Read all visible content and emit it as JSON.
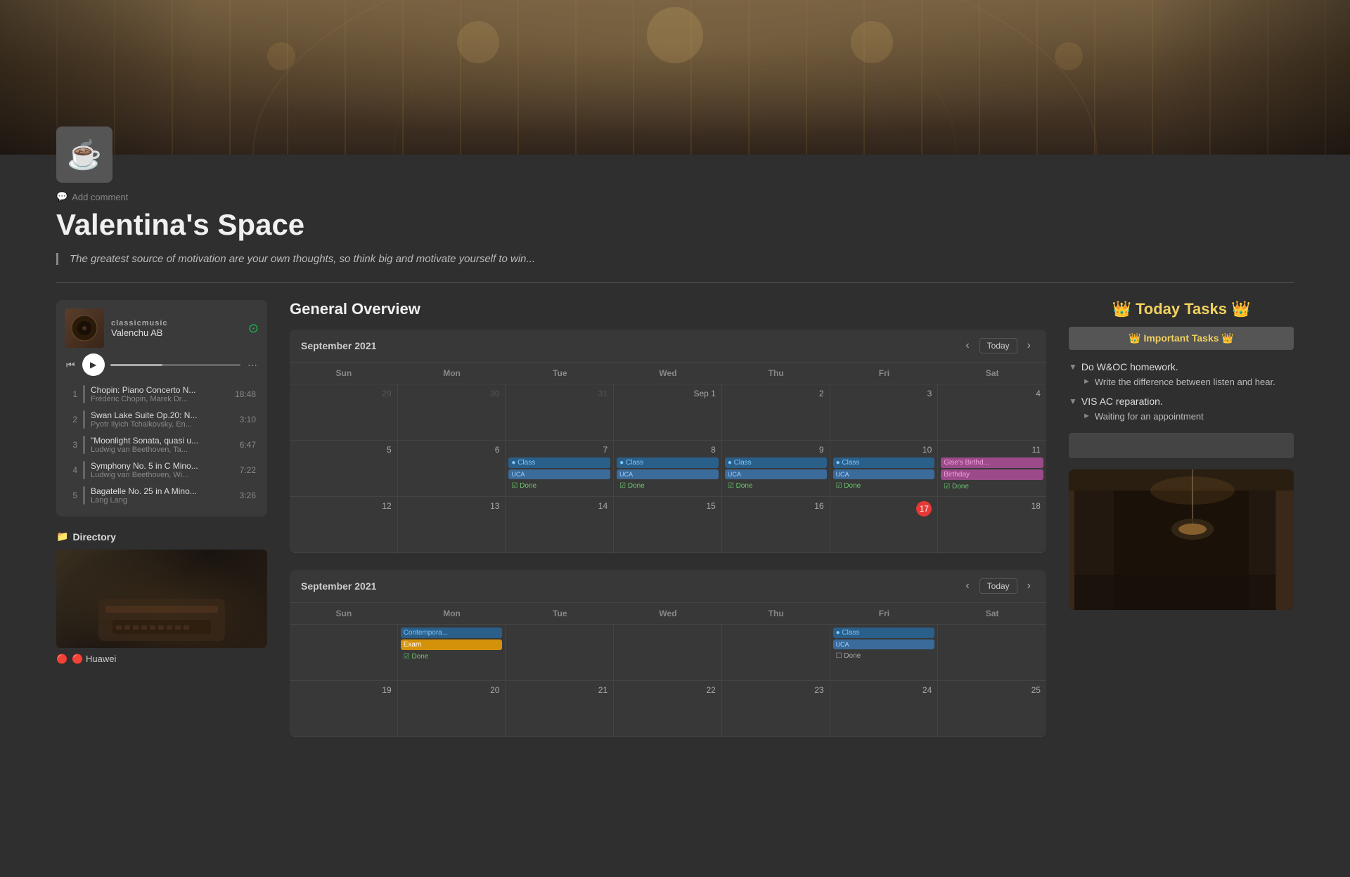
{
  "header": {
    "banner_alt": "Library grand hall banner"
  },
  "page": {
    "avatar_emoji": "☕",
    "add_comment_label": "Add comment",
    "title": "Valentina's Space",
    "quote": "The greatest source of motivation are your own thoughts, so think big and motivate yourself to win..."
  },
  "music_player": {
    "label": "classicmusic",
    "artist": "Valenchu AB",
    "tracks": [
      {
        "num": "1",
        "title": "Chopin: Piano Concerto N...",
        "artist": "Frédéric Chopin, Marek Dr...",
        "duration": "18:48"
      },
      {
        "num": "2",
        "title": "Swan Lake Suite Op.20: N...",
        "artist": "Pyotr Ilyich Tchaikovsky, En...",
        "duration": "3:10"
      },
      {
        "num": "3",
        "title": "\"Moonlight Sonata, quasi u...",
        "artist": "Ludwig van Beethoven, Ta...",
        "duration": "6:47"
      },
      {
        "num": "4",
        "title": "Symphony No. 5 in C Mino...",
        "artist": "Ludwig van Beethoven, Wi...",
        "duration": "7:22"
      },
      {
        "num": "5",
        "title": "Bagatelle No. 25 in A Mino...",
        "artist": "Lang Lang",
        "duration": "3:26"
      }
    ]
  },
  "directory": {
    "title": "📁 Directory",
    "label": "🔴 Huawei"
  },
  "calendar": {
    "title": "General Overview",
    "month1": "September 2021",
    "month2": "September 2021",
    "today_label": "Today",
    "days": [
      "Sun",
      "Mon",
      "Tue",
      "Wed",
      "Thu",
      "Fri",
      "Sat"
    ],
    "week1": [
      {
        "date": "29",
        "other": true,
        "events": []
      },
      {
        "date": "30",
        "other": true,
        "events": []
      },
      {
        "date": "31",
        "other": true,
        "events": []
      },
      {
        "date": "Sep 1",
        "today_styled": true,
        "events": []
      },
      {
        "date": "2",
        "events": []
      },
      {
        "date": "3",
        "events": []
      },
      {
        "date": "4",
        "events": []
      }
    ],
    "week2": [
      {
        "date": "5",
        "events": []
      },
      {
        "date": "6",
        "events": []
      },
      {
        "date": "7",
        "events": [
          {
            "type": "class",
            "label": "Class"
          },
          {
            "type": "uca",
            "label": "UCA"
          },
          {
            "type": "done",
            "label": "Done"
          }
        ]
      },
      {
        "date": "8",
        "events": [
          {
            "type": "class",
            "label": "Class"
          },
          {
            "type": "uca",
            "label": "UCA"
          },
          {
            "type": "done",
            "label": "Done"
          }
        ]
      },
      {
        "date": "9",
        "events": [
          {
            "type": "class",
            "label": "Class"
          },
          {
            "type": "uca",
            "label": "UCA"
          },
          {
            "type": "done",
            "label": "Done"
          }
        ]
      },
      {
        "date": "10",
        "events": [
          {
            "type": "class",
            "label": "Class"
          },
          {
            "type": "uca",
            "label": "UCA"
          },
          {
            "type": "done",
            "label": "Done"
          }
        ]
      },
      {
        "date": "11",
        "events": [
          {
            "type": "birthday",
            "label": "Gise's Birthd..."
          },
          {
            "type": "birthday_tag",
            "label": "Birthday"
          },
          {
            "type": "done",
            "label": "Done"
          }
        ]
      }
    ],
    "week3_dates": [
      "12",
      "13",
      "14",
      "15",
      "16",
      "17",
      "18"
    ],
    "today_date": "17",
    "second_calendar": {
      "week1": [
        {
          "date": "",
          "events": []
        },
        {
          "date": "",
          "events": [
            {
              "type": "contemporary",
              "label": "Contempora..."
            },
            {
              "type": "exam",
              "label": "Exam"
            },
            {
              "type": "done",
              "label": "Done"
            }
          ]
        },
        {
          "date": "",
          "events": []
        },
        {
          "date": "",
          "events": []
        },
        {
          "date": "",
          "events": []
        },
        {
          "date": "",
          "events": [
            {
              "type": "class",
              "label": "Class"
            },
            {
              "type": "uca",
              "label": "UCA"
            },
            {
              "type": "done",
              "label": "Done"
            }
          ]
        },
        {
          "date": "",
          "events": []
        }
      ],
      "week2_dates": [
        "19",
        "20",
        "21",
        "22",
        "23",
        "24",
        "25"
      ]
    }
  },
  "tasks": {
    "title": "👑 Today Tasks 👑",
    "important_label": "👑 Important Tasks 👑",
    "groups": [
      {
        "id": "group1",
        "title": "Do W&OC homework.",
        "items": [
          "Write the difference between listen and hear."
        ]
      },
      {
        "id": "group2",
        "title": "VIS AC reparation.",
        "items": [
          "Waiting for an appointment"
        ]
      }
    ]
  }
}
